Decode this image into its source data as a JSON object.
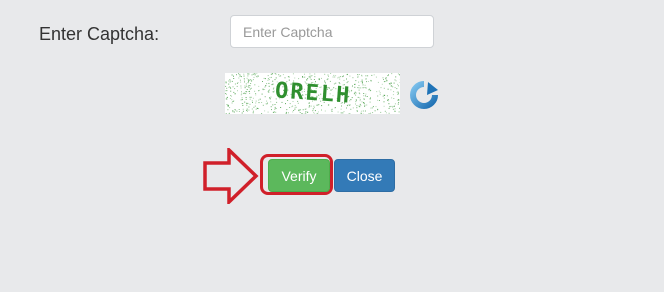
{
  "form": {
    "captcha_label": "Enter Captcha:",
    "captcha_input_value": "",
    "captcha_input_placeholder": "Enter Captcha",
    "captcha_image_text": "ORELH"
  },
  "buttons": {
    "verify_label": "Verify",
    "close_label": "Close",
    "refresh_icon": "refresh-icon"
  },
  "annotation": {
    "arrow_icon": "right-arrow-icon",
    "highlight_color": "#d0202a"
  },
  "colors": {
    "page_background": "#e8e9eb",
    "verify_button": "#5cb85c",
    "close_button": "#337ab7",
    "refresh_icon": "#2a7fc2"
  }
}
